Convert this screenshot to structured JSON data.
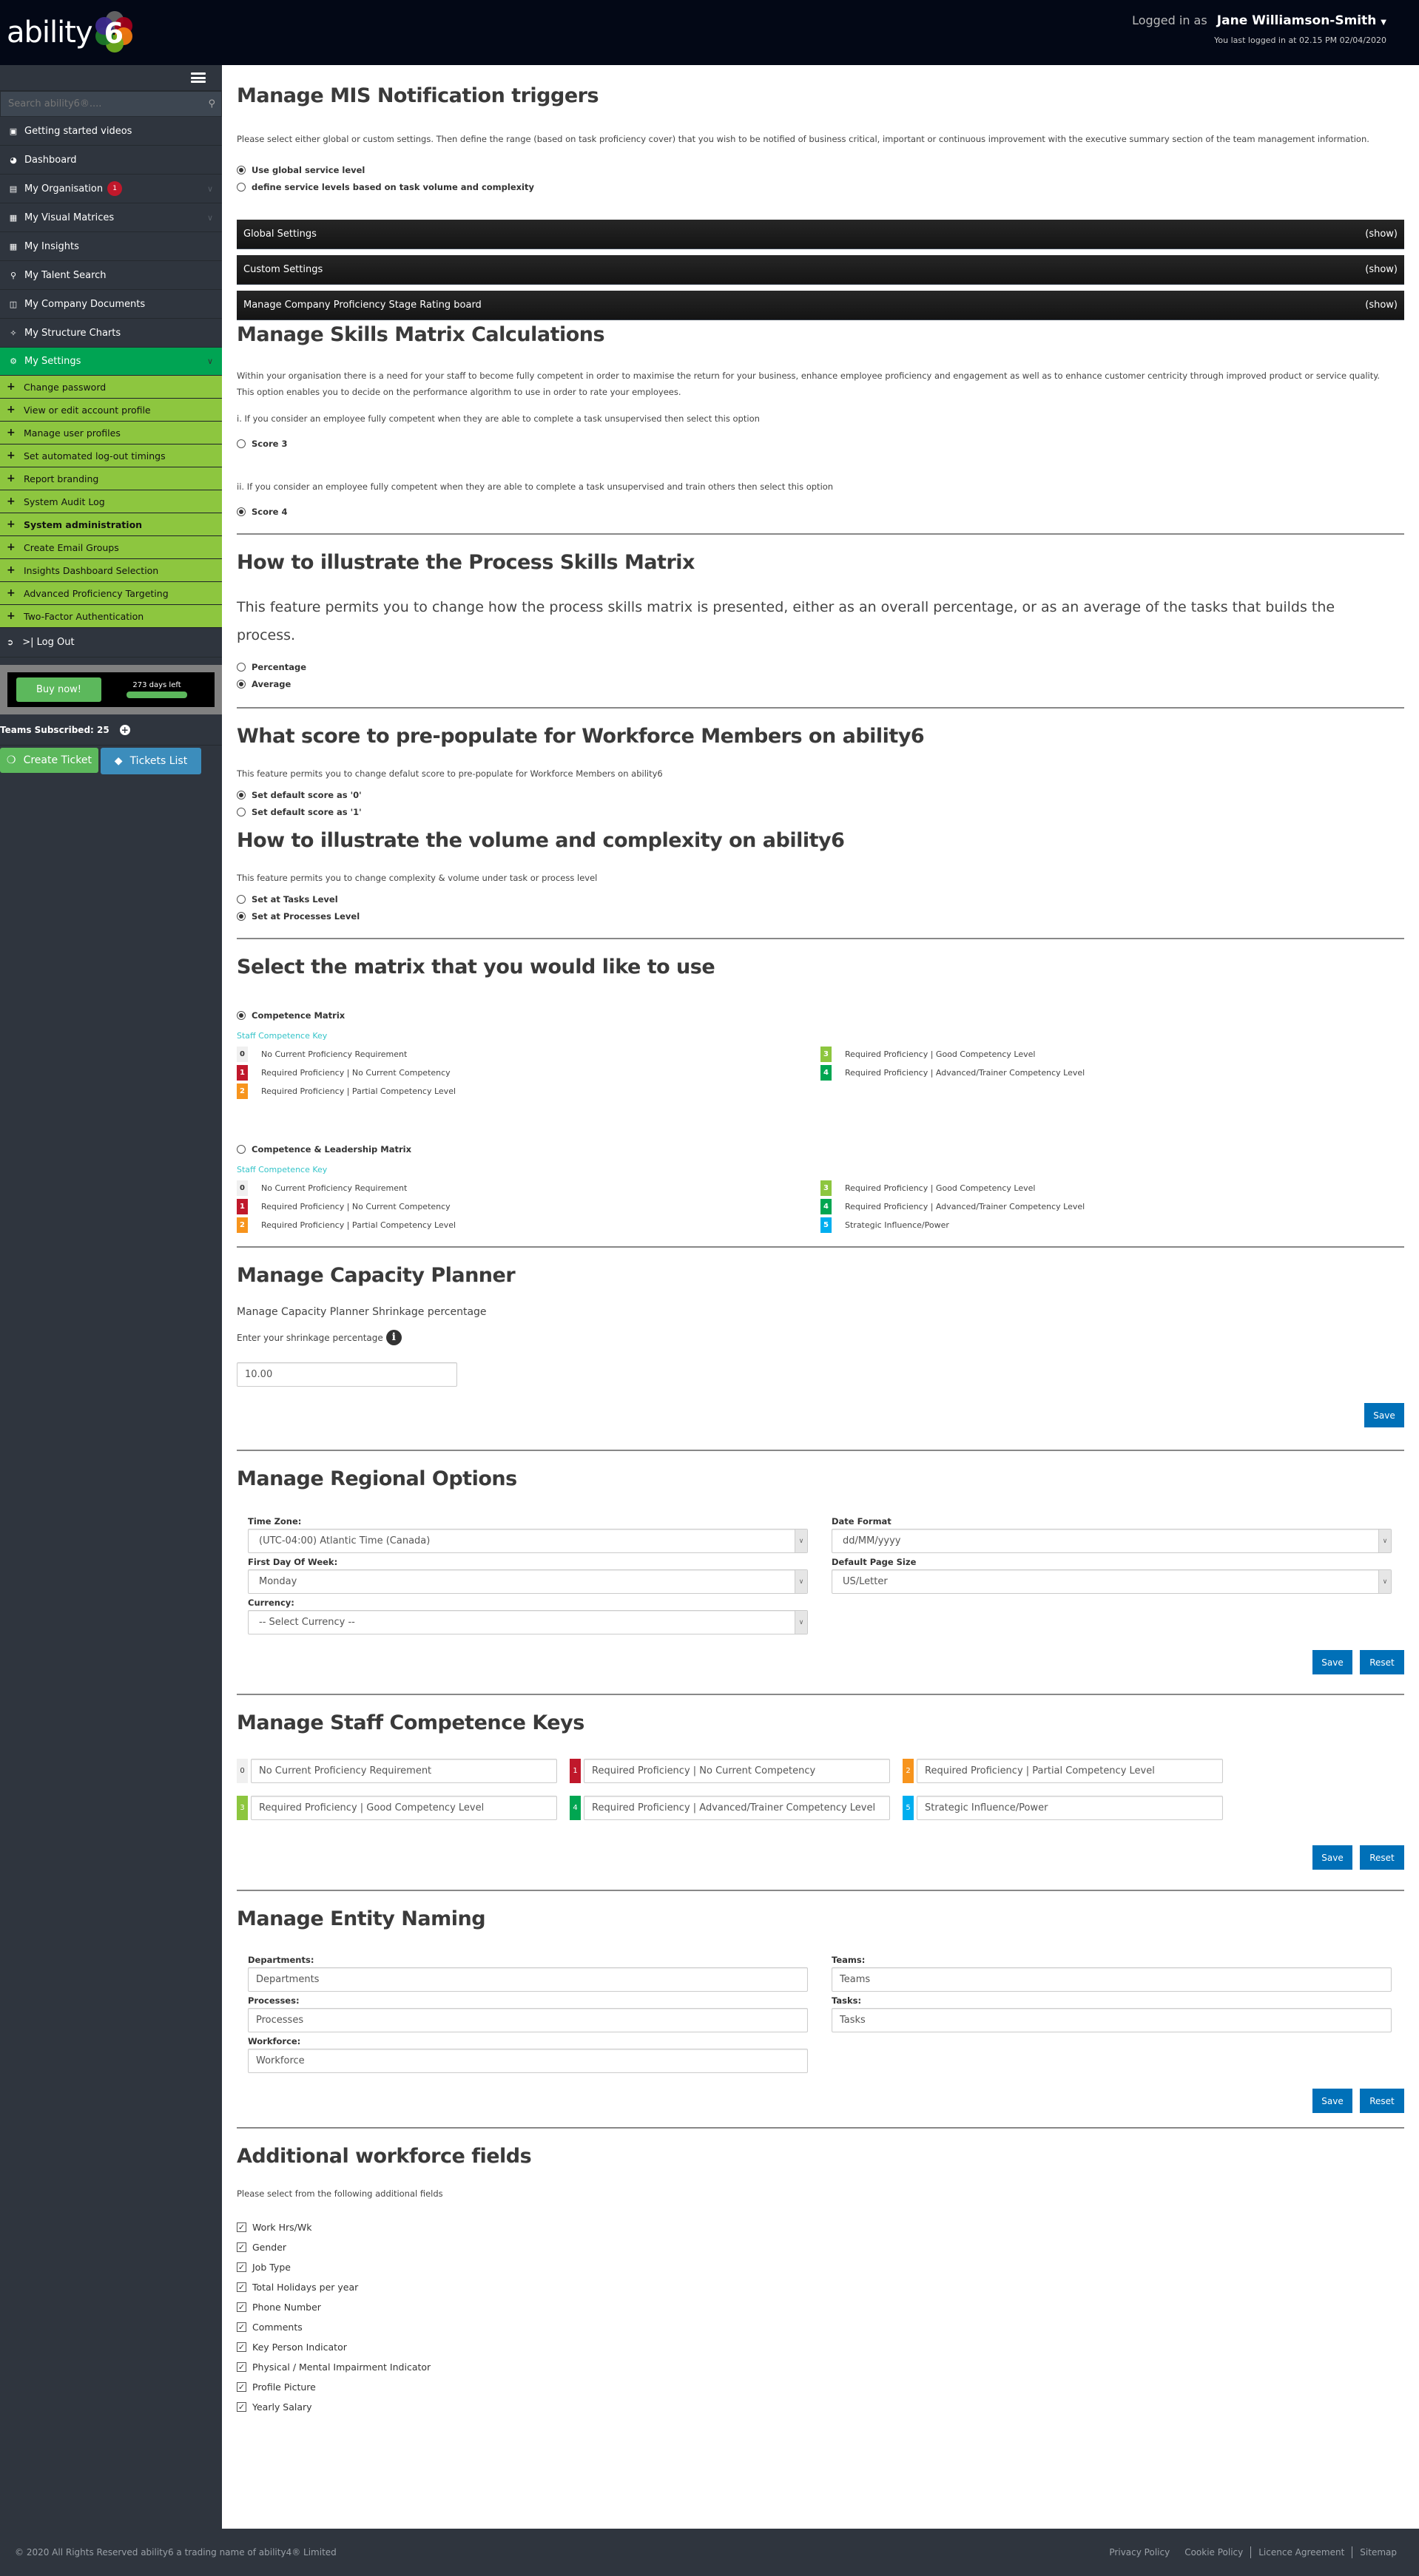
{
  "header": {
    "logo_text": "ability",
    "logo_number": "6",
    "logged_in_label": "Logged in as",
    "user_name": "Jane Williamson-Smith",
    "last_login": "You last logged in at 02.15 PM 02/04/2020"
  },
  "sidebar": {
    "search_placeholder": "Search ability6®....",
    "items": [
      {
        "label": "Getting started videos",
        "icon": "video-camera-icon"
      },
      {
        "label": "Dashboard",
        "icon": "dashboard-icon"
      },
      {
        "label": "My Organisation",
        "icon": "server-icon",
        "badge": "1",
        "expandable": true
      },
      {
        "label": "My Visual Matrices",
        "icon": "grid-icon",
        "expandable": true
      },
      {
        "label": "My Insights",
        "icon": "grid-icon"
      },
      {
        "label": "My Talent Search",
        "icon": "search-icon"
      },
      {
        "label": "My Company Documents",
        "icon": "book-icon"
      },
      {
        "label": "My Structure Charts",
        "icon": "network-icon"
      },
      {
        "label": "My Settings",
        "icon": "gears-icon",
        "active": true,
        "expandable": true
      }
    ],
    "settings_subitems": [
      {
        "label": "Change password"
      },
      {
        "label": "View or edit account profile"
      },
      {
        "label": "Manage user profiles"
      },
      {
        "label": "Set automated log-out timings"
      },
      {
        "label": "Report branding"
      },
      {
        "label": "System Audit Log"
      },
      {
        "label": "System administration",
        "current": true
      },
      {
        "label": "Create Email Groups"
      },
      {
        "label": "Insights Dashboard Selection"
      },
      {
        "label": "Advanced Proficiency Targeting"
      },
      {
        "label": "Two-Factor Authentication"
      }
    ],
    "logout_label": ">| Log Out",
    "buy_now_label": "Buy now!",
    "days_left_label": "273 days left",
    "days_left_fraction": 1.0,
    "teams_subscribed": "Teams Subscribed: 25",
    "create_ticket_label": "Create Ticket",
    "tickets_list_label": "Tickets List"
  },
  "mis": {
    "title": "Manage MIS Notification triggers",
    "description": "Please select either global or custom settings. Then define the range (based on task proficiency cover) that you wish to be notified of business critical, important or continuous improvement with the executive summary section of the team management information.",
    "options": [
      {
        "label": "Use global service level",
        "selected": true
      },
      {
        "label": "define service levels based on task volume and complexity",
        "selected": false
      }
    ],
    "panels": [
      {
        "label": "Global Settings",
        "toggle": "(show)"
      },
      {
        "label": "Custom Settings",
        "toggle": "(show)"
      },
      {
        "label": "Manage Company Proficiency Stage Rating board",
        "toggle": "(show)"
      }
    ]
  },
  "skills_calc": {
    "title": "Manage Skills Matrix Calculations",
    "description1": "Within your organisation there is a need for your staff to become fully competent in order to maximise the return for your business, enhance employee proficiency and engagement as well as to enhance customer centricity through improved product or service quality.",
    "description2": "This option enables you to decide on the performance algorithm to use in order to rate your employees.",
    "option1_text": "i. If you consider an employee fully competent when they are able to complete a task unsupervised then select this option",
    "option1_label": "Score 3",
    "option1_selected": false,
    "option2_text": "ii. If you consider an employee fully competent when they are able to complete a task unsupervised and train others then select this option",
    "option2_label": "Score 4",
    "option2_selected": true
  },
  "process_matrix": {
    "title": "How to illustrate the Process Skills Matrix",
    "description": "This feature permits you to change how the process skills matrix is presented, either as an overall percentage, or as an average of the tasks that builds the process.",
    "options": [
      {
        "label": "Percentage",
        "selected": false
      },
      {
        "label": "Average",
        "selected": true
      }
    ]
  },
  "prepopulate": {
    "title": "What score to pre-populate for Workforce Members on ability6",
    "description": "This feature permits you to change defalut score to pre-populate for Workforce Members on ability6",
    "options": [
      {
        "label": "Set default score as '0'",
        "selected": true
      },
      {
        "label": "Set default score as '1'",
        "selected": false
      }
    ]
  },
  "volume": {
    "title": "How to illustrate the volume and complexity on ability6",
    "description": "This feature permits you to change complexity & volume under task or process level",
    "options": [
      {
        "label": "Set at Tasks Level",
        "selected": false
      },
      {
        "label": "Set at Processes Level",
        "selected": true
      }
    ]
  },
  "matrix_select": {
    "title": "Select the matrix that you would like to use",
    "key_title": "Staff Competence Key",
    "competence": {
      "label": "Competence Matrix",
      "selected": true,
      "left": [
        {
          "num": "0",
          "label": "No Current Proficiency Requirement",
          "color": "#f0f0f0"
        },
        {
          "num": "1",
          "label": "Required Proficiency | No Current Competency",
          "color": "#c0182b"
        },
        {
          "num": "2",
          "label": "Required Proficiency | Partial Competency Level",
          "color": "#f7941d"
        }
      ],
      "right": [
        {
          "num": "3",
          "label": "Required Proficiency | Good Competency Level",
          "color": "#8dc63f"
        },
        {
          "num": "4",
          "label": "Required Proficiency | Advanced/Trainer Competency Level",
          "color": "#00a651"
        }
      ]
    },
    "leadership": {
      "label": "Competence & Leadership Matrix",
      "selected": false,
      "left": [
        {
          "num": "0",
          "label": "No Current Proficiency Requirement",
          "color": "#f0f0f0"
        },
        {
          "num": "1",
          "label": "Required Proficiency | No Current Competency",
          "color": "#c0182b"
        },
        {
          "num": "2",
          "label": "Required Proficiency | Partial Competency Level",
          "color": "#f7941d"
        }
      ],
      "right": [
        {
          "num": "3",
          "label": "Required Proficiency | Good Competency Level",
          "color": "#8dc63f"
        },
        {
          "num": "4",
          "label": "Required Proficiency | Advanced/Trainer Competency Level",
          "color": "#00a651"
        },
        {
          "num": "5",
          "label": "Strategic Influence/Power",
          "color": "#00aeef"
        }
      ]
    }
  },
  "capacity": {
    "title": "Manage Capacity Planner",
    "subtitle": "Manage Capacity Planner Shrinkage percentage",
    "field_label": "Enter your shrinkage percentage",
    "value": "10.00",
    "save_label": "Save"
  },
  "regional": {
    "title": "Manage Regional Options",
    "time_zone_label": "Time Zone:",
    "time_zone_value": "(UTC-04:00) Atlantic Time (Canada)",
    "date_format_label": "Date Format",
    "date_format_value": "dd/MM/yyyy",
    "first_day_label": "First Day Of Week:",
    "first_day_value": "Monday",
    "page_size_label": "Default Page Size",
    "page_size_value": "US/Letter",
    "currency_label": "Currency:",
    "currency_value": "-- Select Currency --",
    "save_label": "Save",
    "reset_label": "Reset"
  },
  "keys": {
    "title": "Manage Staff Competence Keys",
    "items": [
      {
        "num": "0",
        "value": "No Current Proficiency Requirement",
        "color": "#f0f0f0"
      },
      {
        "num": "1",
        "value": "Required Proficiency | No Current Competency",
        "color": "#c0182b"
      },
      {
        "num": "2",
        "value": "Required Proficiency | Partial Competency Level",
        "color": "#f7941d"
      },
      {
        "num": "3",
        "value": "Required Proficiency | Good Competency Level",
        "color": "#8dc63f"
      },
      {
        "num": "4",
        "value": "Required Proficiency | Advanced/Trainer Competency Level",
        "color": "#00a651"
      },
      {
        "num": "5",
        "value": "Strategic Influence/Power",
        "color": "#00aeef"
      }
    ],
    "save_label": "Save",
    "reset_label": "Reset"
  },
  "entity": {
    "title": "Manage Entity Naming",
    "departments_label": "Departments:",
    "departments_value": "Departments",
    "teams_label": "Teams:",
    "teams_value": "Teams",
    "processes_label": "Processes:",
    "processes_value": "Processes",
    "tasks_label": "Tasks:",
    "tasks_value": "Tasks",
    "workforce_label": "Workforce:",
    "workforce_value": "Workforce",
    "save_label": "Save",
    "reset_label": "Reset"
  },
  "additional": {
    "title": "Additional workforce fields",
    "description": "Please select from the following additional fields",
    "fields": [
      {
        "label": "Work Hrs/Wk",
        "checked": true
      },
      {
        "label": "Gender",
        "checked": true
      },
      {
        "label": "Job Type",
        "checked": true
      },
      {
        "label": "Total Holidays per year",
        "checked": true
      },
      {
        "label": "Phone Number",
        "checked": true
      },
      {
        "label": "Comments",
        "checked": true
      },
      {
        "label": "Key Person Indicator",
        "checked": true
      },
      {
        "label": "Physical / Mental Impairment Indicator",
        "checked": true
      },
      {
        "label": "Profile Picture",
        "checked": true
      },
      {
        "label": "Yearly Salary",
        "checked": true
      }
    ]
  },
  "footer": {
    "copyright": "© 2020 All Rights Reserved ability6 a trading name of ability4® Limited",
    "links": [
      "Privacy Policy",
      "Cookie Policy",
      "Licence Agreement",
      "Sitemap"
    ]
  }
}
